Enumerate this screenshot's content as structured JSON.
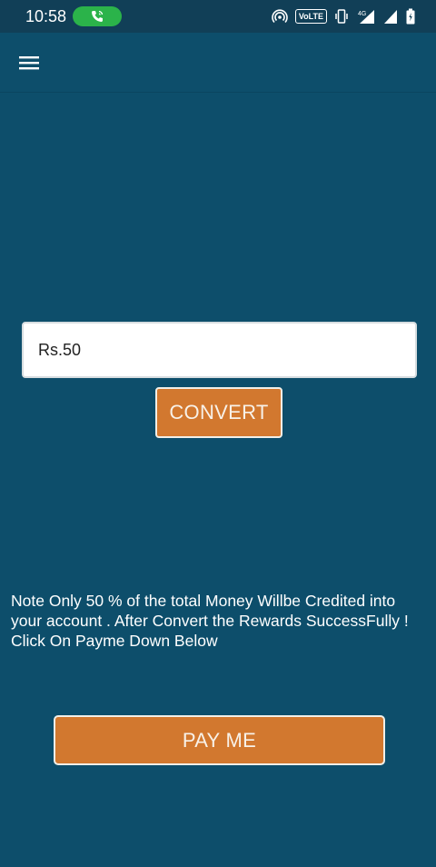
{
  "status_bar": {
    "time": "10:58",
    "call_icon": "phone-call-icon",
    "network_label": "VoLTE",
    "signal_label": "4G",
    "icons": [
      "hotspot-icon",
      "volte-badge",
      "vibrate-icon",
      "signal-4g-icon",
      "signal-icon",
      "battery-icon"
    ],
    "call_color": "#2bb34a"
  },
  "app_bar": {
    "menu_icon": "hamburger-menu-icon"
  },
  "form": {
    "amount_value": "Rs.50",
    "convert_label": "CONVERT"
  },
  "note": {
    "text": "Note Only 50 % of the total Money Willbe Credited into your account . After Convert the Rewards SuccessFully ! Click On Payme Down Below"
  },
  "footer": {
    "pay_label": "PAY ME"
  },
  "colors": {
    "background": "#0d4e6b",
    "status_bar": "#113f57",
    "accent_button": "#d2782f",
    "button_border": "#f1efe8"
  }
}
